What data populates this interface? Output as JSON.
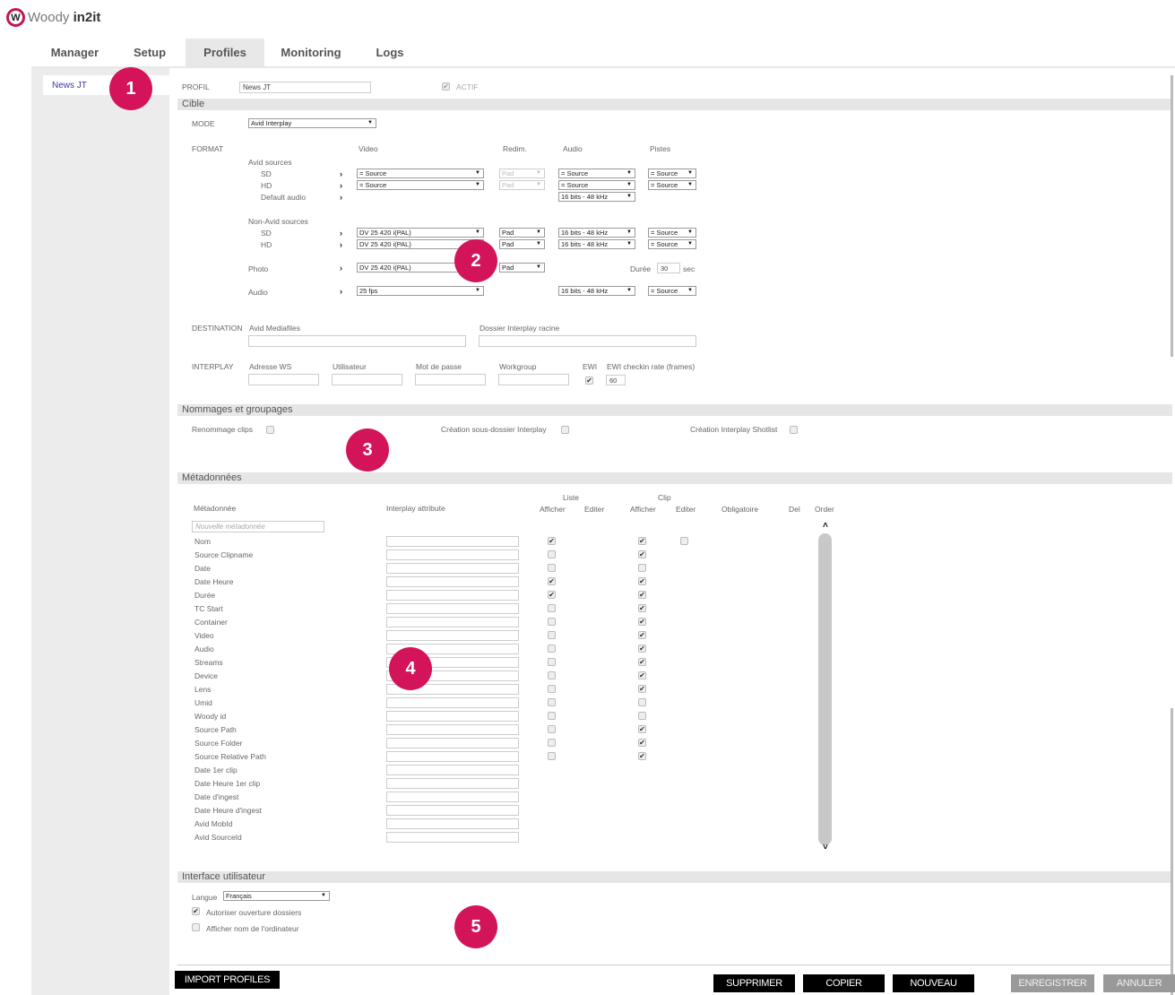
{
  "app": {
    "logo_letter": "W",
    "brand_light": "Woody ",
    "brand_bold": "in2it"
  },
  "tabs": [
    "Manager",
    "Setup",
    "Profiles",
    "Monitoring",
    "Logs"
  ],
  "sidebar": {
    "profile": "News JT"
  },
  "profil": {
    "label": "PROFIL",
    "value": "News JT",
    "actif": "ACTIF"
  },
  "cible": {
    "title": "Cible",
    "mode_label": "MODE",
    "mode_value": "Avid Interplay",
    "format_label": "FORMAT",
    "col_video": "Video",
    "col_redim": "Redim.",
    "col_audio": "Audio",
    "col_pistes": "Pistes",
    "avid_sources": "Avid sources",
    "sd": "SD",
    "hd": "HD",
    "default_audio": "Default audio",
    "non_avid_sources": "Non-Avid sources",
    "photo": "Photo",
    "audio": "Audio",
    "v_source": "= Source",
    "v_dv": "DV 25 420 i(PAL)",
    "v_fps": "25 fps",
    "r_pad": "Pad",
    "a_source": "= Source",
    "a_16": "16 bits - 48 kHz",
    "p_source": "= Source",
    "duree_label": "Durée",
    "duree_value": "30",
    "sec": "sec",
    "destination_label": "DESTINATION",
    "avid_mediafiles": "Avid Mediafiles",
    "dossier_interplay": "Dossier Interplay racine",
    "interplay_label": "INTERPLAY",
    "adresse_ws": "Adresse WS",
    "utilisateur": "Utilisateur",
    "mot_de_passe": "Mot de passe",
    "workgroup": "Workgroup",
    "ewi": "EWI",
    "ewi_rate": "EWI checkin rate (frames)",
    "ewi_rate_value": "60"
  },
  "nommages": {
    "title": "Nommages et groupages",
    "renommage": "Renommage clips",
    "sous_dossier": "Création sous-dossier Interplay",
    "shotlist": "Création Interplay Shotlist"
  },
  "metadonnees": {
    "title": "Métadonnées",
    "col_meta": "Métadonnée",
    "col_attr": "Interplay attribute",
    "grp_liste": "Liste",
    "grp_clip": "Clip",
    "col_afficher": "Afficher",
    "col_editer": "Editer",
    "col_obligatoire": "Obligatoire",
    "col_del": "Del",
    "col_order": "Order",
    "new_placeholder": "Nouvelle métadonnée",
    "rows": [
      {
        "name": "Nom",
        "la": true,
        "ca": true,
        "ce": false
      },
      {
        "name": "Source Clipname",
        "la": false,
        "ca": true
      },
      {
        "name": "Date",
        "la": false,
        "ca": false
      },
      {
        "name": "Date Heure",
        "la": true,
        "ca": true
      },
      {
        "name": "Durée",
        "la": true,
        "ca": true
      },
      {
        "name": "TC Start",
        "la": false,
        "ca": true
      },
      {
        "name": "Container",
        "la": false,
        "ca": true
      },
      {
        "name": "Video",
        "la": false,
        "ca": true
      },
      {
        "name": "Audio",
        "la": false,
        "ca": true
      },
      {
        "name": "Streams",
        "la": false,
        "ca": true
      },
      {
        "name": "Device",
        "la": false,
        "ca": true
      },
      {
        "name": "Lens",
        "la": false,
        "ca": true
      },
      {
        "name": "Umid",
        "la": false,
        "ca": false
      },
      {
        "name": "Woody id",
        "la": false,
        "ca": false
      },
      {
        "name": "Source Path",
        "la": false,
        "ca": true
      },
      {
        "name": "Source Folder",
        "la": false,
        "ca": true
      },
      {
        "name": "Source Relative Path",
        "la": false,
        "ca": true
      },
      {
        "name": "Date 1er clip"
      },
      {
        "name": "Date Heure 1er clip"
      },
      {
        "name": "Date d'ingest"
      },
      {
        "name": "Date Heure d'ingest"
      },
      {
        "name": "Avid MobId"
      },
      {
        "name": "Avid SourceId"
      }
    ]
  },
  "ui": {
    "title": "Interface utilisateur",
    "langue": "Langue",
    "langue_value": "Français",
    "autoriser": "Autoriser ouverture dossiers",
    "afficher_nom": "Afficher nom de l'ordinateur"
  },
  "badges": [
    "1",
    "2",
    "3",
    "4",
    "5"
  ],
  "buttons": {
    "import": "IMPORT PROFILES",
    "supprimer": "SUPPRIMER",
    "copier": "COPIER",
    "nouveau": "NOUVEAU",
    "enregistrer": "ENREGISTRER",
    "annuler": "ANNULER"
  },
  "colors": {
    "accent": "#d4145a",
    "logo": "#c0185a",
    "link": "#3a3aa0"
  }
}
